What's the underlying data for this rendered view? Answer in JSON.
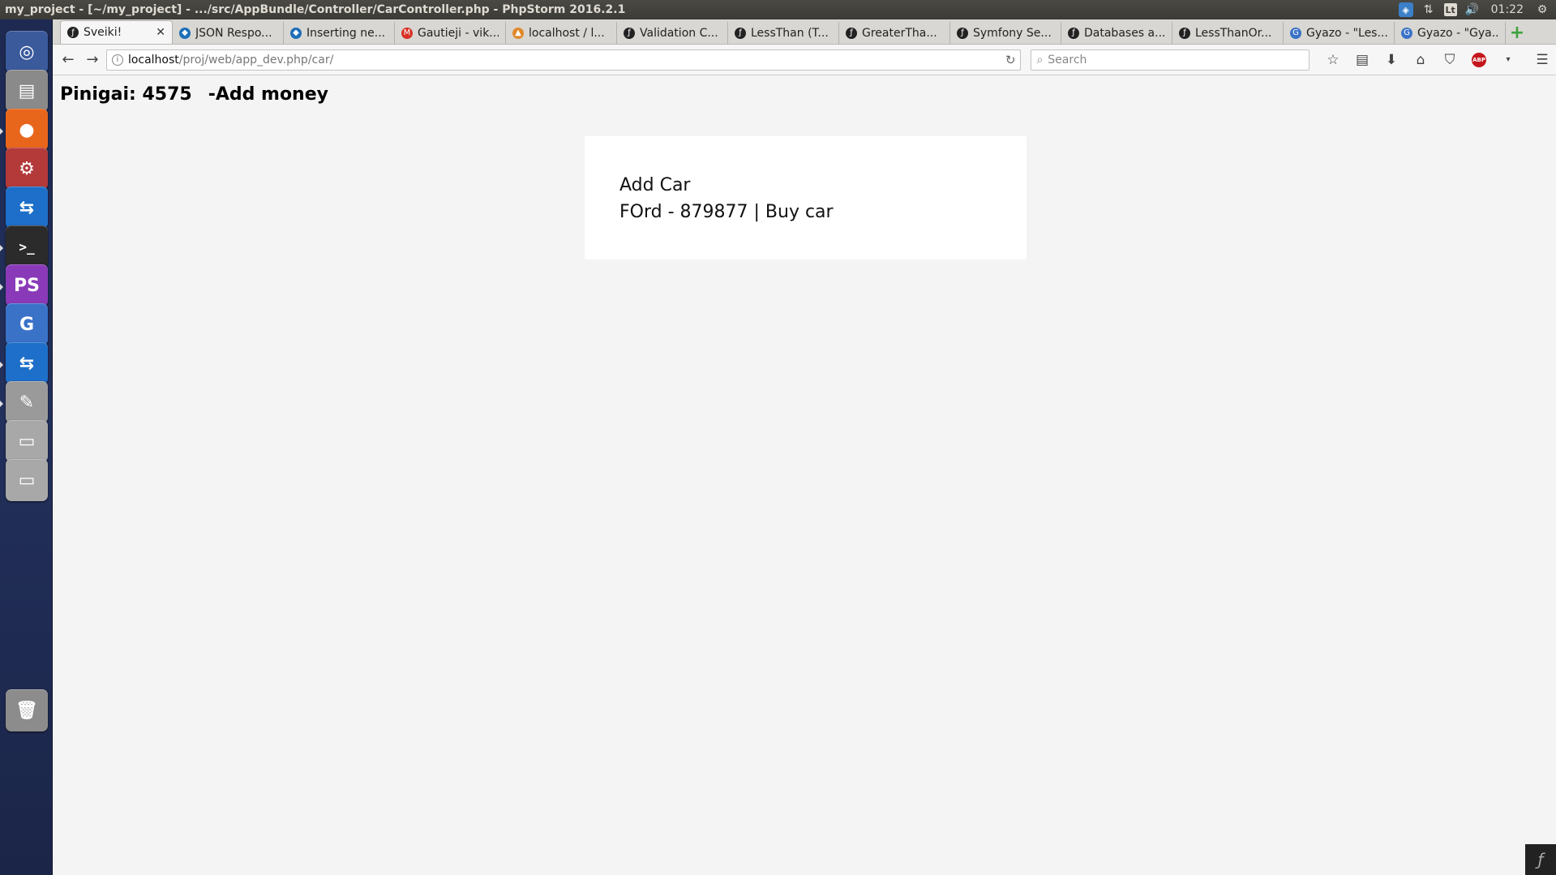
{
  "system_panel": {
    "window_title": "my_project - [~/my_project] - .../src/AppBundle/Controller/CarController.php - PhpStorm 2016.2.1",
    "keyboard_layout": "Lt",
    "clock": "01:22"
  },
  "launcher": {
    "items": [
      {
        "name": "ubuntu-dash-icon",
        "color": "#3a5a9c",
        "glyph": "◎"
      },
      {
        "name": "files-icon",
        "color": "#8a8a8a",
        "glyph": "▤"
      },
      {
        "name": "firefox-icon",
        "color": "#e8661c",
        "glyph": "●"
      },
      {
        "name": "system-settings-icon",
        "color": "#b43a3a",
        "glyph": "⚙"
      },
      {
        "name": "teamviewer-icon",
        "color": "#1d6fc9",
        "glyph": "⇆"
      },
      {
        "name": "terminal-icon",
        "color": "#2b2b2b",
        "glyph": ">_"
      },
      {
        "name": "phpstorm-icon",
        "color": "#8a3ab8",
        "glyph": "PS"
      },
      {
        "name": "gyazo-icon",
        "color": "#3a72c8",
        "glyph": "G"
      },
      {
        "name": "teamviewer-2-icon",
        "color": "#1d6fc9",
        "glyph": "⇆"
      },
      {
        "name": "text-editor-icon",
        "color": "#9a9a9a",
        "glyph": "✎"
      },
      {
        "name": "drive-icon",
        "color": "#a8a8a8",
        "glyph": "▭"
      },
      {
        "name": "drive-2-icon",
        "color": "#a8a8a8",
        "glyph": "▭"
      },
      {
        "name": "trash-icon",
        "color": "#8c8c8c",
        "glyph": "🗑"
      }
    ]
  },
  "tabs": [
    {
      "label": "Sveiki!",
      "fav": "#222",
      "glyph": "ƒ",
      "active": true
    },
    {
      "label": "JSON Respo...",
      "fav": "#1d6fb8",
      "glyph": "◆"
    },
    {
      "label": "Inserting ne...",
      "fav": "#1d6fb8",
      "glyph": "◆"
    },
    {
      "label": "Gautieji - vik...",
      "fav": "#d93025",
      "glyph": "M"
    },
    {
      "label": "localhost / l...",
      "fav": "#e0892b",
      "glyph": "▲"
    },
    {
      "label": "Validation C...",
      "fav": "#222",
      "glyph": "ƒ"
    },
    {
      "label": "LessThan (T...",
      "fav": "#222",
      "glyph": "ƒ"
    },
    {
      "label": "GreaterTha...",
      "fav": "#222",
      "glyph": "ƒ"
    },
    {
      "label": "Symfony Se...",
      "fav": "#222",
      "glyph": "ƒ"
    },
    {
      "label": "Databases a...",
      "fav": "#222",
      "glyph": "ƒ"
    },
    {
      "label": "LessThanOr...",
      "fav": "#222",
      "glyph": "ƒ"
    },
    {
      "label": "Gyazo - \"Les...",
      "fav": "#3a72c8",
      "glyph": "G"
    },
    {
      "label": "Gyazo - \"Gya...",
      "fav": "#3a72c8",
      "glyph": "G"
    }
  ],
  "address_bar": {
    "host": "localhost",
    "path": "/proj/web/app_dev.php/car/"
  },
  "search_bar": {
    "placeholder": "Search"
  },
  "page": {
    "balance_label": "Pinigai: 4575",
    "add_money_link": "-Add money",
    "add_car_link": "Add Car",
    "car_entry": "FOrd - 879877 | ",
    "buy_car_link": "Buy car"
  }
}
